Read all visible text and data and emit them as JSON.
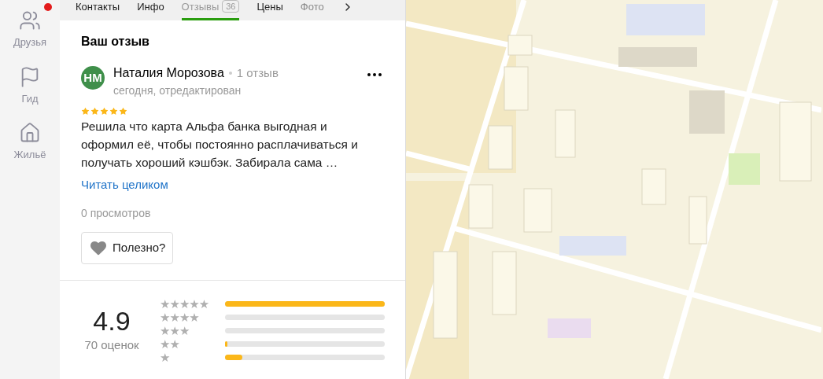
{
  "sidebar": {
    "items": [
      {
        "label": "Друзья",
        "kind": "friends",
        "badge": true
      },
      {
        "label": "Гид",
        "kind": "flag",
        "badge": false
      },
      {
        "label": "Жильё",
        "kind": "home",
        "badge": false
      }
    ]
  },
  "tabs": [
    {
      "label": "Контакты",
      "selected": false
    },
    {
      "label": "Инфо",
      "selected": false
    },
    {
      "label": "Отзывы",
      "count": "36",
      "selected": true
    },
    {
      "label": "Цены",
      "selected": false
    },
    {
      "label": "Фото",
      "selected": false,
      "disabled": true
    }
  ],
  "review": {
    "heading": "Ваш отзыв",
    "initials": "НМ",
    "author": "Наталия Морозова",
    "author_reviews": "1 отзыв",
    "date": "сегодня, отредактирован",
    "stars": 5,
    "text": "Решила что карта Альфа банка выгодная и оформил её, чтобы постоянно расплачиваться и получать хороший кэшбэк. Забирала сама …",
    "read_more": "Читать целиком",
    "views": "0 просмотров",
    "helpful": "Полезно?"
  },
  "rating": {
    "score": "4.9",
    "count": "70 оценок",
    "distribution": [
      {
        "label": "★★★★★",
        "level": 1.0
      },
      {
        "label": "★★★★",
        "level": 0
      },
      {
        "label": "★★★",
        "level": 0
      },
      {
        "label": "★★",
        "level": 0.015
      },
      {
        "label": "★",
        "level": 0.11
      }
    ]
  }
}
